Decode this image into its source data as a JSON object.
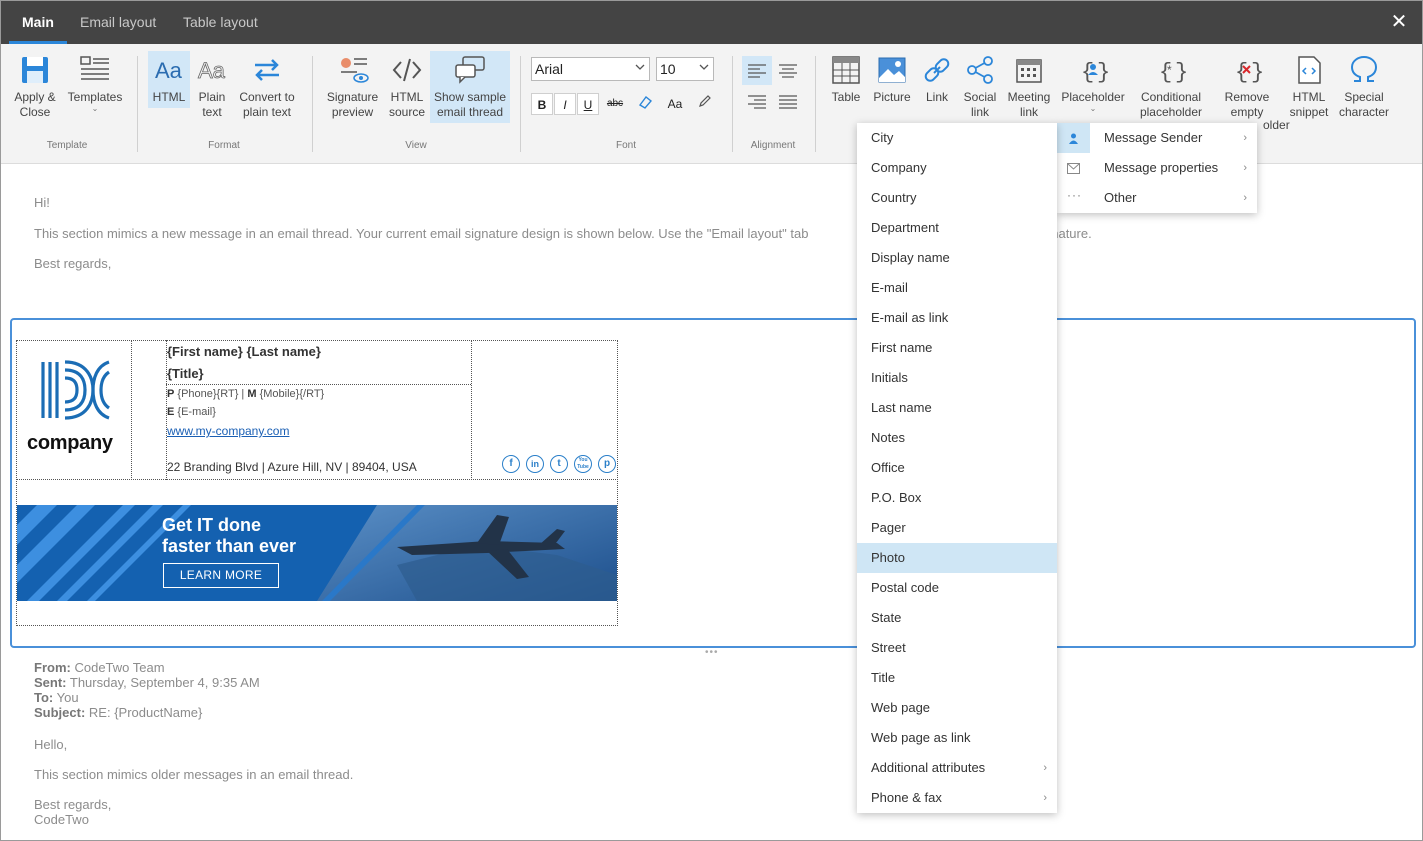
{
  "tabs": [
    {
      "label": "Main",
      "active": true
    },
    {
      "label": "Email layout",
      "active": false
    },
    {
      "label": "Table layout",
      "active": false
    }
  ],
  "ribbon": {
    "template_group": "Template",
    "apply_close": "Apply &\nClose",
    "templates": "Templates",
    "format_group": "Format",
    "html": "HTML",
    "plain_text": "Plain\ntext",
    "convert_plain": "Convert to\nplain text",
    "view_group": "View",
    "signature_preview": "Signature\npreview",
    "html_source": "HTML\nsource",
    "show_sample": "Show sample\nemail thread",
    "font_group": "Font",
    "font_name": "Arial",
    "font_size": "10",
    "alignment_group": "Alignment",
    "table": "Table",
    "picture": "Picture",
    "link": "Link",
    "social_link": "Social\nlink",
    "meeting_link": "Meeting\nlink",
    "placeholder": "Placeholder",
    "conditional_placeholder": "Conditional\nplaceholder",
    "remove_empty": "Remove\nempty",
    "remove_empty_tail": "older",
    "html_snippet": "HTML\nsnippet",
    "special_character": "Special\ncharacter"
  },
  "message": {
    "greeting": "Hi!",
    "body": "This section mimics a new message in an email thread. Your current email signature design is shown below. Use the \"Email layout\" tab",
    "body_tail": "gnature.",
    "closing": "Best regards,"
  },
  "signature": {
    "logo_text": "company",
    "name": "{First name} {Last name}",
    "title": "{Title}",
    "phone_prefix": "P",
    "phone": "{Phone}{RT} |",
    "mobile_prefix": "M",
    "mobile": "{Mobile}{/RT}",
    "email_prefix": "E",
    "email": "{E-mail}",
    "website": "www.my-company.com",
    "address": "22 Branding Blvd | Azure Hill, NV | 89404, USA",
    "social": [
      "f",
      "in",
      "t",
      "You Tube",
      "p"
    ],
    "banner_line1": "Get IT done",
    "banner_line2": "faster than ever",
    "banner_button": "LEARN MORE"
  },
  "thread": {
    "from_label": "From:",
    "from": "CodeTwo Team",
    "sent_label": "Sent:",
    "sent": "Thursday, September 4, 9:35 AM",
    "to_label": "To:",
    "to": "You",
    "subject_label": "Subject:",
    "subject": "RE: {ProductName}",
    "hello": "Hello,",
    "body": "This section mimics older messages in an email thread.",
    "closing1": "Best regards,",
    "closing2": "CodeTwo"
  },
  "placeholder_menu": {
    "items": [
      {
        "label": "Message Sender",
        "icon": "person-icon"
      },
      {
        "label": "Message properties",
        "icon": "envelope-icon"
      },
      {
        "label": "Other",
        "icon": "more-icon"
      }
    ]
  },
  "sender_menu": {
    "items": [
      "City",
      "Company",
      "Country",
      "Department",
      "Display name",
      "E-mail",
      "E-mail as link",
      "First name",
      "Initials",
      "Last name",
      "Notes",
      "Office",
      "P.O. Box",
      "Pager",
      "Photo",
      "Postal code",
      "State",
      "Street",
      "Title",
      "Web page",
      "Web page as link",
      "Additional attributes",
      "Phone & fax"
    ],
    "highlighted": "Photo",
    "submenu_items": [
      "Additional attributes",
      "Phone & fax"
    ]
  },
  "colors": {
    "accent": "#2b86d9",
    "tabbar": "#444444",
    "highlight": "#cfe6f5"
  }
}
